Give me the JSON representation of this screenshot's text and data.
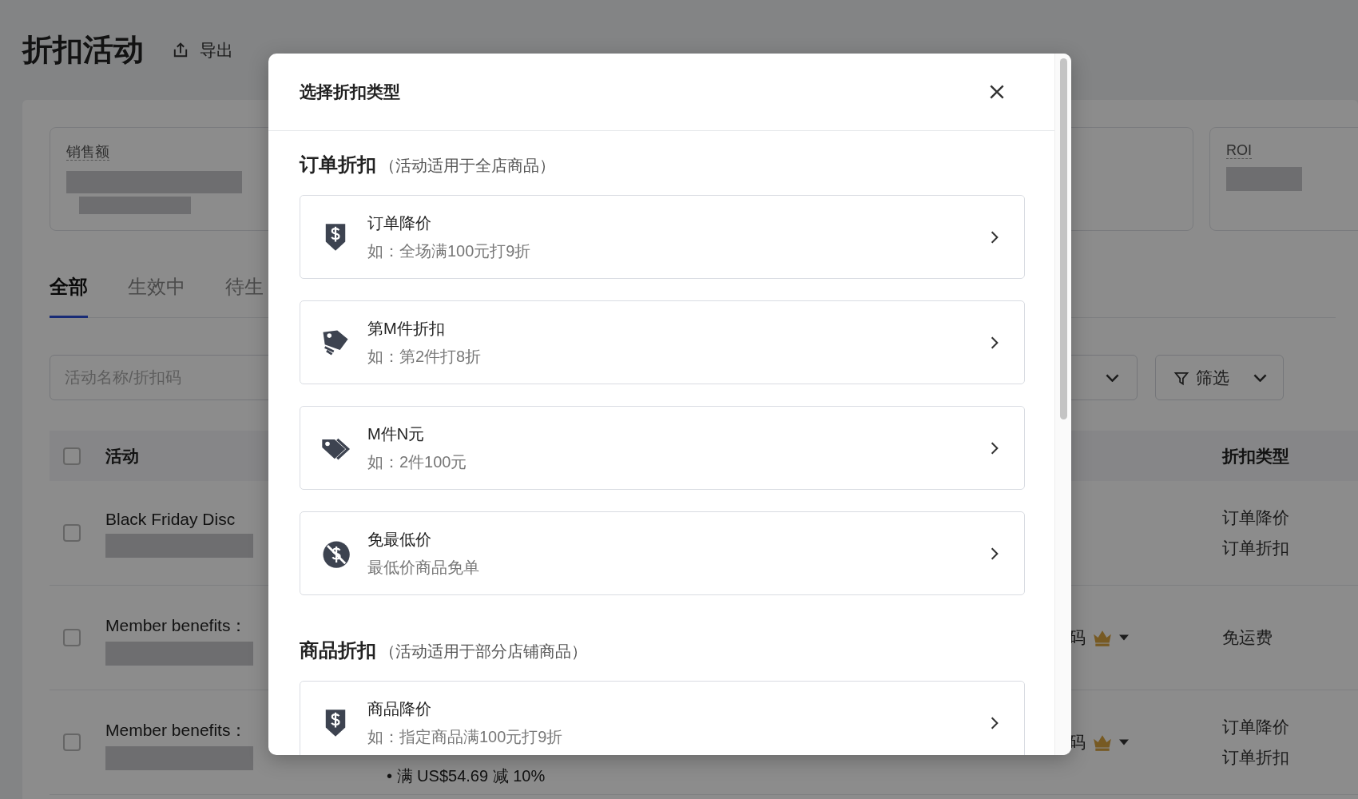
{
  "page": {
    "title": "折扣活动",
    "export_label": "导出"
  },
  "stats": [
    {
      "label": "销售额"
    },
    {
      "label": "ROI"
    }
  ],
  "tabs": [
    {
      "label": "全部",
      "selected": true
    },
    {
      "label": "生效中",
      "selected": false
    },
    {
      "label": "待生",
      "selected": false
    }
  ],
  "search": {
    "placeholder": "活动名称/折扣码"
  },
  "filter_button": {
    "label": "筛选"
  },
  "table": {
    "columns": [
      "活动",
      "折扣类型"
    ],
    "all_checked": false,
    "rows": [
      {
        "checked": false,
        "activity": "Black Friday Disc",
        "types": [
          "订单降价",
          "订单折扣"
        ]
      },
      {
        "checked": false,
        "activity": "Member benefits：",
        "method": "码",
        "types": [
          "免运费"
        ]
      },
      {
        "checked": false,
        "activity": "Member benefits：",
        "method": "码",
        "detail": "• 满 US$54.69 减 10%",
        "types": [
          "订单降价",
          "订单折扣"
        ]
      }
    ]
  },
  "modal": {
    "title": "选择折扣类型",
    "sections": [
      {
        "heading": "订单折扣",
        "note": "（活动适用于全店商品）",
        "options": [
          {
            "kind": "price-drop",
            "title": "订单降价",
            "desc": "如：全场满100元打9折"
          },
          {
            "kind": "tag",
            "title": "第M件折扣",
            "desc": "如：第2件打8折"
          },
          {
            "kind": "double-tag",
            "title": "M件N元",
            "desc": "如：2件100元"
          },
          {
            "kind": "no-dollar",
            "title": "免最低价",
            "desc": "最低价商品免单"
          }
        ]
      },
      {
        "heading": "商品折扣",
        "note": "（活动适用于部分店铺商品）",
        "options": [
          {
            "kind": "price-drop",
            "title": "商品降价",
            "desc": "如：指定商品满100元打9折"
          }
        ]
      }
    ]
  }
}
